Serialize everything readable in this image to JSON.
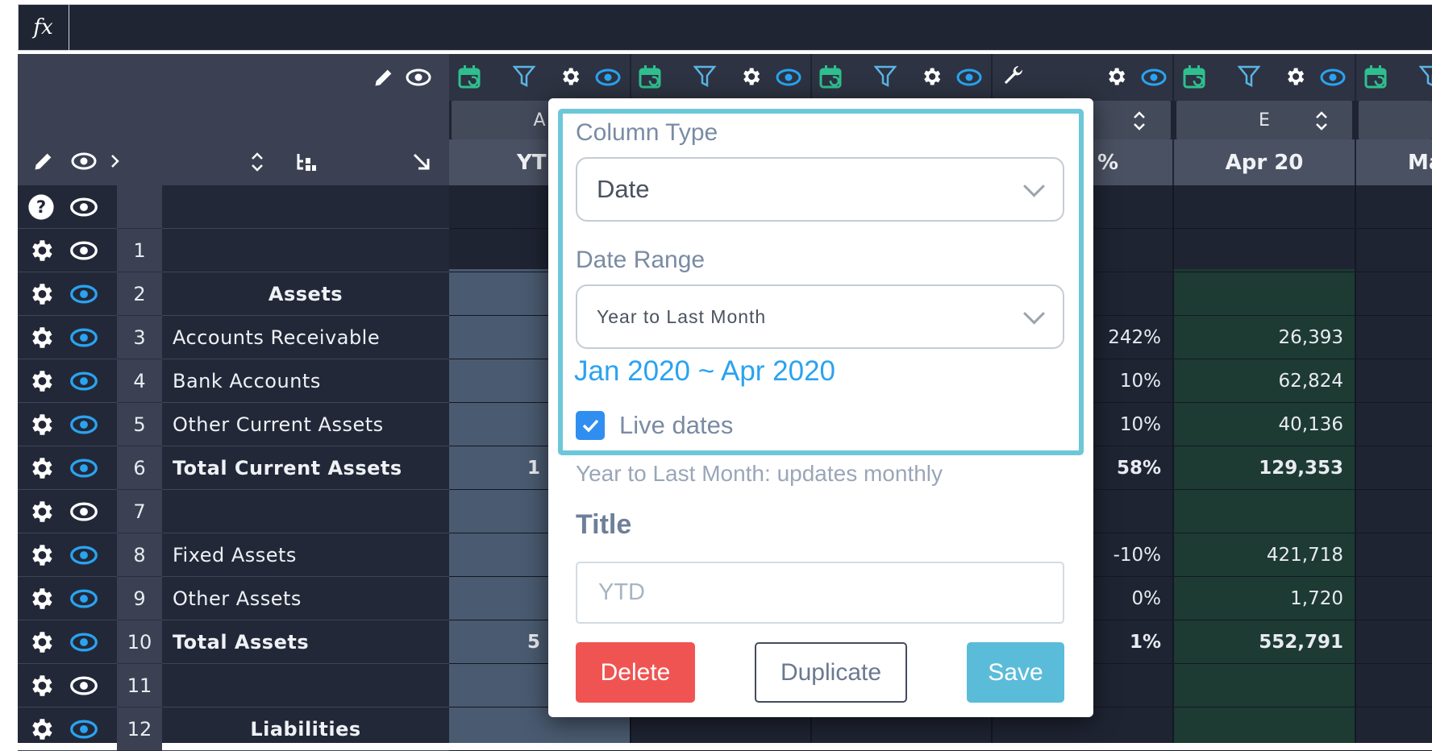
{
  "formula_bar": {
    "fx_label": "fx"
  },
  "grid": {
    "columns": [
      {
        "letter": "A",
        "title": "YTD"
      },
      {
        "letter": "",
        "title": "%"
      },
      {
        "letter": "E",
        "title": "Apr 20"
      },
      {
        "letter": "",
        "title": "Ma"
      }
    ],
    "rows": [
      {
        "num": "",
        "label": "",
        "style": "header"
      },
      {
        "num": "1",
        "label": "",
        "style": "normal"
      },
      {
        "num": "2",
        "label": "Assets",
        "style": "section"
      },
      {
        "num": "3",
        "label": "Accounts Receivable",
        "style": "normal",
        "pct": "242%",
        "apr": "26,393"
      },
      {
        "num": "4",
        "label": "Bank Accounts",
        "style": "normal",
        "pct": "10%",
        "apr": "62,824"
      },
      {
        "num": "5",
        "label": "Other Current Assets",
        "style": "normal",
        "pct": "10%",
        "apr": "40,136"
      },
      {
        "num": "6",
        "label": "Total Current Assets",
        "style": "total",
        "pct": "58%",
        "apr": "129,353",
        "ytd_fragment": "1"
      },
      {
        "num": "7",
        "label": "",
        "style": "normal"
      },
      {
        "num": "8",
        "label": "Fixed Assets",
        "style": "normal",
        "pct": "-10%",
        "apr": "421,718"
      },
      {
        "num": "9",
        "label": "Other Assets",
        "style": "normal",
        "pct": "0%",
        "apr": "1,720"
      },
      {
        "num": "10",
        "label": "Total Assets",
        "style": "total",
        "pct": "1%",
        "apr": "552,791",
        "ytd_fragment": "5"
      },
      {
        "num": "11",
        "label": "",
        "style": "normal"
      },
      {
        "num": "12",
        "label": "Liabilities",
        "style": "section"
      }
    ]
  },
  "modal": {
    "column_type_label": "Column Type",
    "column_type_value": "Date",
    "date_range_label": "Date Range",
    "date_range_value": "Year to Last Month",
    "date_span": "Jan 2020 ~ Apr 2020",
    "live_dates_label": "Live dates",
    "live_dates_checked": true,
    "hint": "Year to Last Month: updates monthly",
    "title_label": "Title",
    "title_placeholder": "YTD",
    "delete_label": "Delete",
    "duplicate_label": "Duplicate",
    "save_label": "Save"
  },
  "colors": {
    "accent": "#6cc7d9",
    "link_blue": "#2aa3f0",
    "delete_red": "#f05452",
    "save_blue": "#5bbcd9",
    "calendar_green": "#2fbf8f",
    "panel_dark": "#232838"
  }
}
